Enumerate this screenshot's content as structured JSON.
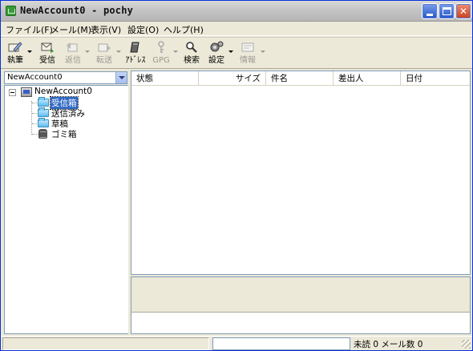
{
  "window": {
    "title": "NewAccount0 - pochy"
  },
  "menu": [
    "ファイル(F)",
    "メール(M)",
    "表示(V)",
    "設定(O)",
    "ヘルプ(H)"
  ],
  "toolbar": [
    {
      "label": "執筆",
      "icon": "compose-icon",
      "enabled": true,
      "dropdown": true
    },
    {
      "label": "受信",
      "icon": "receive-icon",
      "enabled": true,
      "dropdown": false
    },
    {
      "label": "返信",
      "icon": "reply-icon",
      "enabled": false,
      "dropdown": true
    },
    {
      "label": "転送",
      "icon": "forward-icon",
      "enabled": false,
      "dropdown": true
    },
    {
      "label": "ｱﾄﾞﾚｽ",
      "icon": "address-book-icon",
      "enabled": true,
      "dropdown": false
    },
    {
      "label": "GPG",
      "icon": "key-icon",
      "enabled": false,
      "dropdown": true
    },
    {
      "label": "検索",
      "icon": "search-icon",
      "enabled": true,
      "dropdown": false
    },
    {
      "label": "設定",
      "icon": "settings-gear-icon",
      "enabled": true,
      "dropdown": true
    },
    {
      "label": "情報",
      "icon": "info-icon",
      "enabled": false,
      "dropdown": true
    }
  ],
  "account_select": {
    "value": "NewAccount0"
  },
  "tree": {
    "account": "NewAccount0",
    "folders": [
      {
        "label": "受信箱",
        "icon": "folder-icon",
        "selected": true
      },
      {
        "label": "送信済み",
        "icon": "folder-icon",
        "selected": false
      },
      {
        "label": "草稿",
        "icon": "folder-icon",
        "selected": false
      },
      {
        "label": "ゴミ箱",
        "icon": "trash-icon",
        "selected": false
      }
    ]
  },
  "message_list": {
    "columns": [
      "状態",
      "サイズ",
      "件名",
      "差出人",
      "日付"
    ]
  },
  "statusbar": {
    "text": "未読 0 メール数 0"
  }
}
